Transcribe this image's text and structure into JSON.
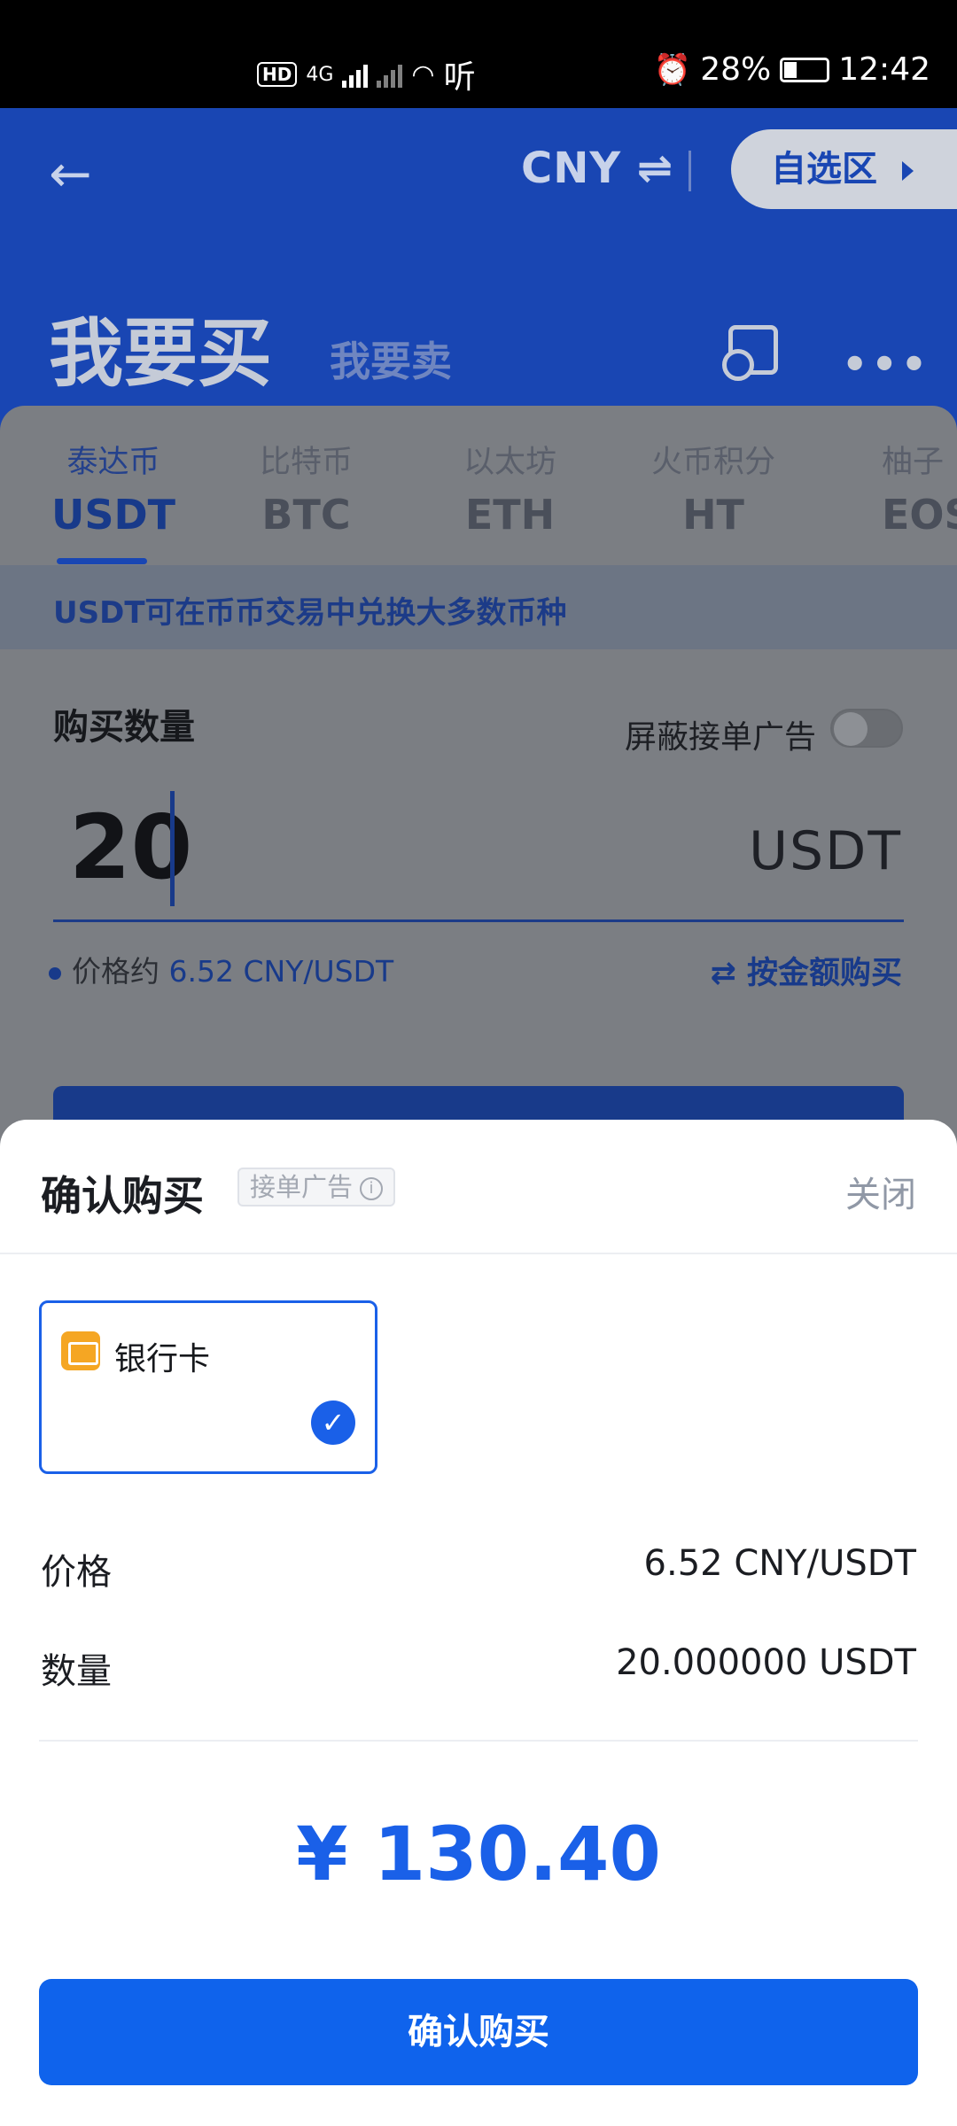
{
  "status_bar": {
    "hd": "HD",
    "network": "4G",
    "listen_icon": "听",
    "battery": "28%",
    "time": "12:42"
  },
  "header": {
    "back_icon": "←",
    "currency": "CNY ⇌",
    "favorites": "自选区",
    "tab_buy": "我要买",
    "tab_sell": "我要卖",
    "more": "•••"
  },
  "coins": [
    {
      "cn": "泰达币",
      "code": "USDT"
    },
    {
      "cn": "比特币",
      "code": "BTC"
    },
    {
      "cn": "以太坊",
      "code": "ETH"
    },
    {
      "cn": "火币积分",
      "code": "HT"
    },
    {
      "cn": "柚子",
      "code": "EOS"
    }
  ],
  "hint": "USDT可在币币交易中兑换大多数币种",
  "form": {
    "quantity_label": "购买数量",
    "block_ads_label": "屏蔽接单广告",
    "quantity_value": "20",
    "unit": "USDT",
    "price_label": "价格约",
    "price_value": "6.52 CNY/USDT",
    "by_amount": "⇄ 按金额购买"
  },
  "sheet": {
    "title": "确认购买",
    "ad_badge": "接单广告",
    "info_icon": "i",
    "close": "关闭",
    "payment_method": "银行卡",
    "check_icon": "✓",
    "price_label": "价格",
    "price_value": "6.52 CNY/USDT",
    "amount_label": "数量",
    "amount_value": "20.000000 USDT",
    "total": "¥ 130.40",
    "confirm_button": "确认购买"
  },
  "colors": {
    "brand_blue": "#1946b3",
    "accent_blue": "#0f63ec",
    "bank_orange": "#f5a623"
  }
}
